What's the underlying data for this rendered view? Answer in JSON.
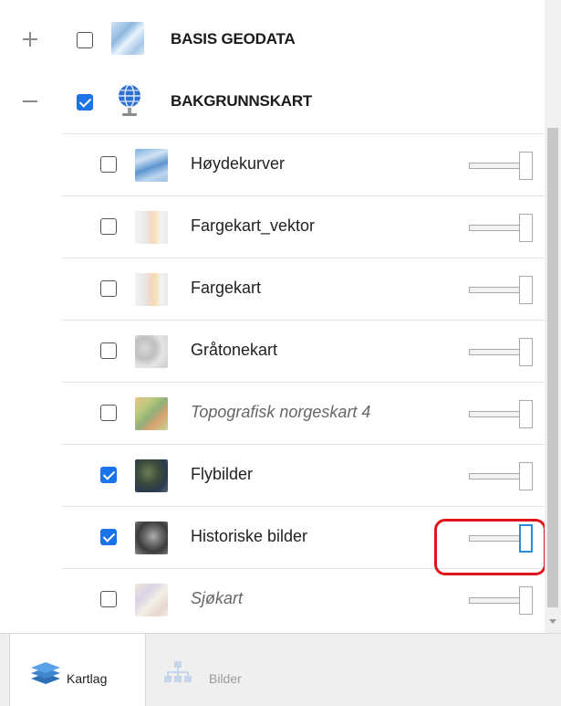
{
  "groups": [
    {
      "label": "BASIS GEODATA",
      "expanded": false,
      "checked": false,
      "icon": "basis-geodata-thumbnail"
    },
    {
      "label": "BAKGRUNNSKART",
      "expanded": true,
      "checked": true,
      "icon": "globe-icon"
    }
  ],
  "layers": [
    {
      "label": "Høydekurver",
      "checked": false,
      "italic": false,
      "slider_opacity": 1.0
    },
    {
      "label": "Fargekart_vektor",
      "checked": false,
      "italic": false,
      "slider_opacity": 1.0
    },
    {
      "label": "Fargekart",
      "checked": false,
      "italic": false,
      "slider_opacity": 1.0
    },
    {
      "label": "Gråtonekart",
      "checked": false,
      "italic": false,
      "slider_opacity": 1.0
    },
    {
      "label": "Topografisk norgeskart 4",
      "checked": false,
      "italic": true,
      "slider_opacity": 1.0
    },
    {
      "label": "Flybilder",
      "checked": true,
      "italic": false,
      "slider_opacity": 1.0
    },
    {
      "label": "Historiske bilder",
      "checked": true,
      "italic": false,
      "slider_opacity": 1.0,
      "slider_focused": true
    },
    {
      "label": "Sjøkart",
      "checked": false,
      "italic": true,
      "slider_opacity": 1.0
    }
  ],
  "tabs": [
    {
      "label": "Kartlag",
      "active": true,
      "icon": "layers-icon"
    },
    {
      "label": "Bilder",
      "active": false,
      "icon": "sitemap-icon"
    }
  ],
  "colors": {
    "accent": "#1a73e8",
    "highlight": "#e0151b",
    "focus": "#2d8bd4"
  }
}
